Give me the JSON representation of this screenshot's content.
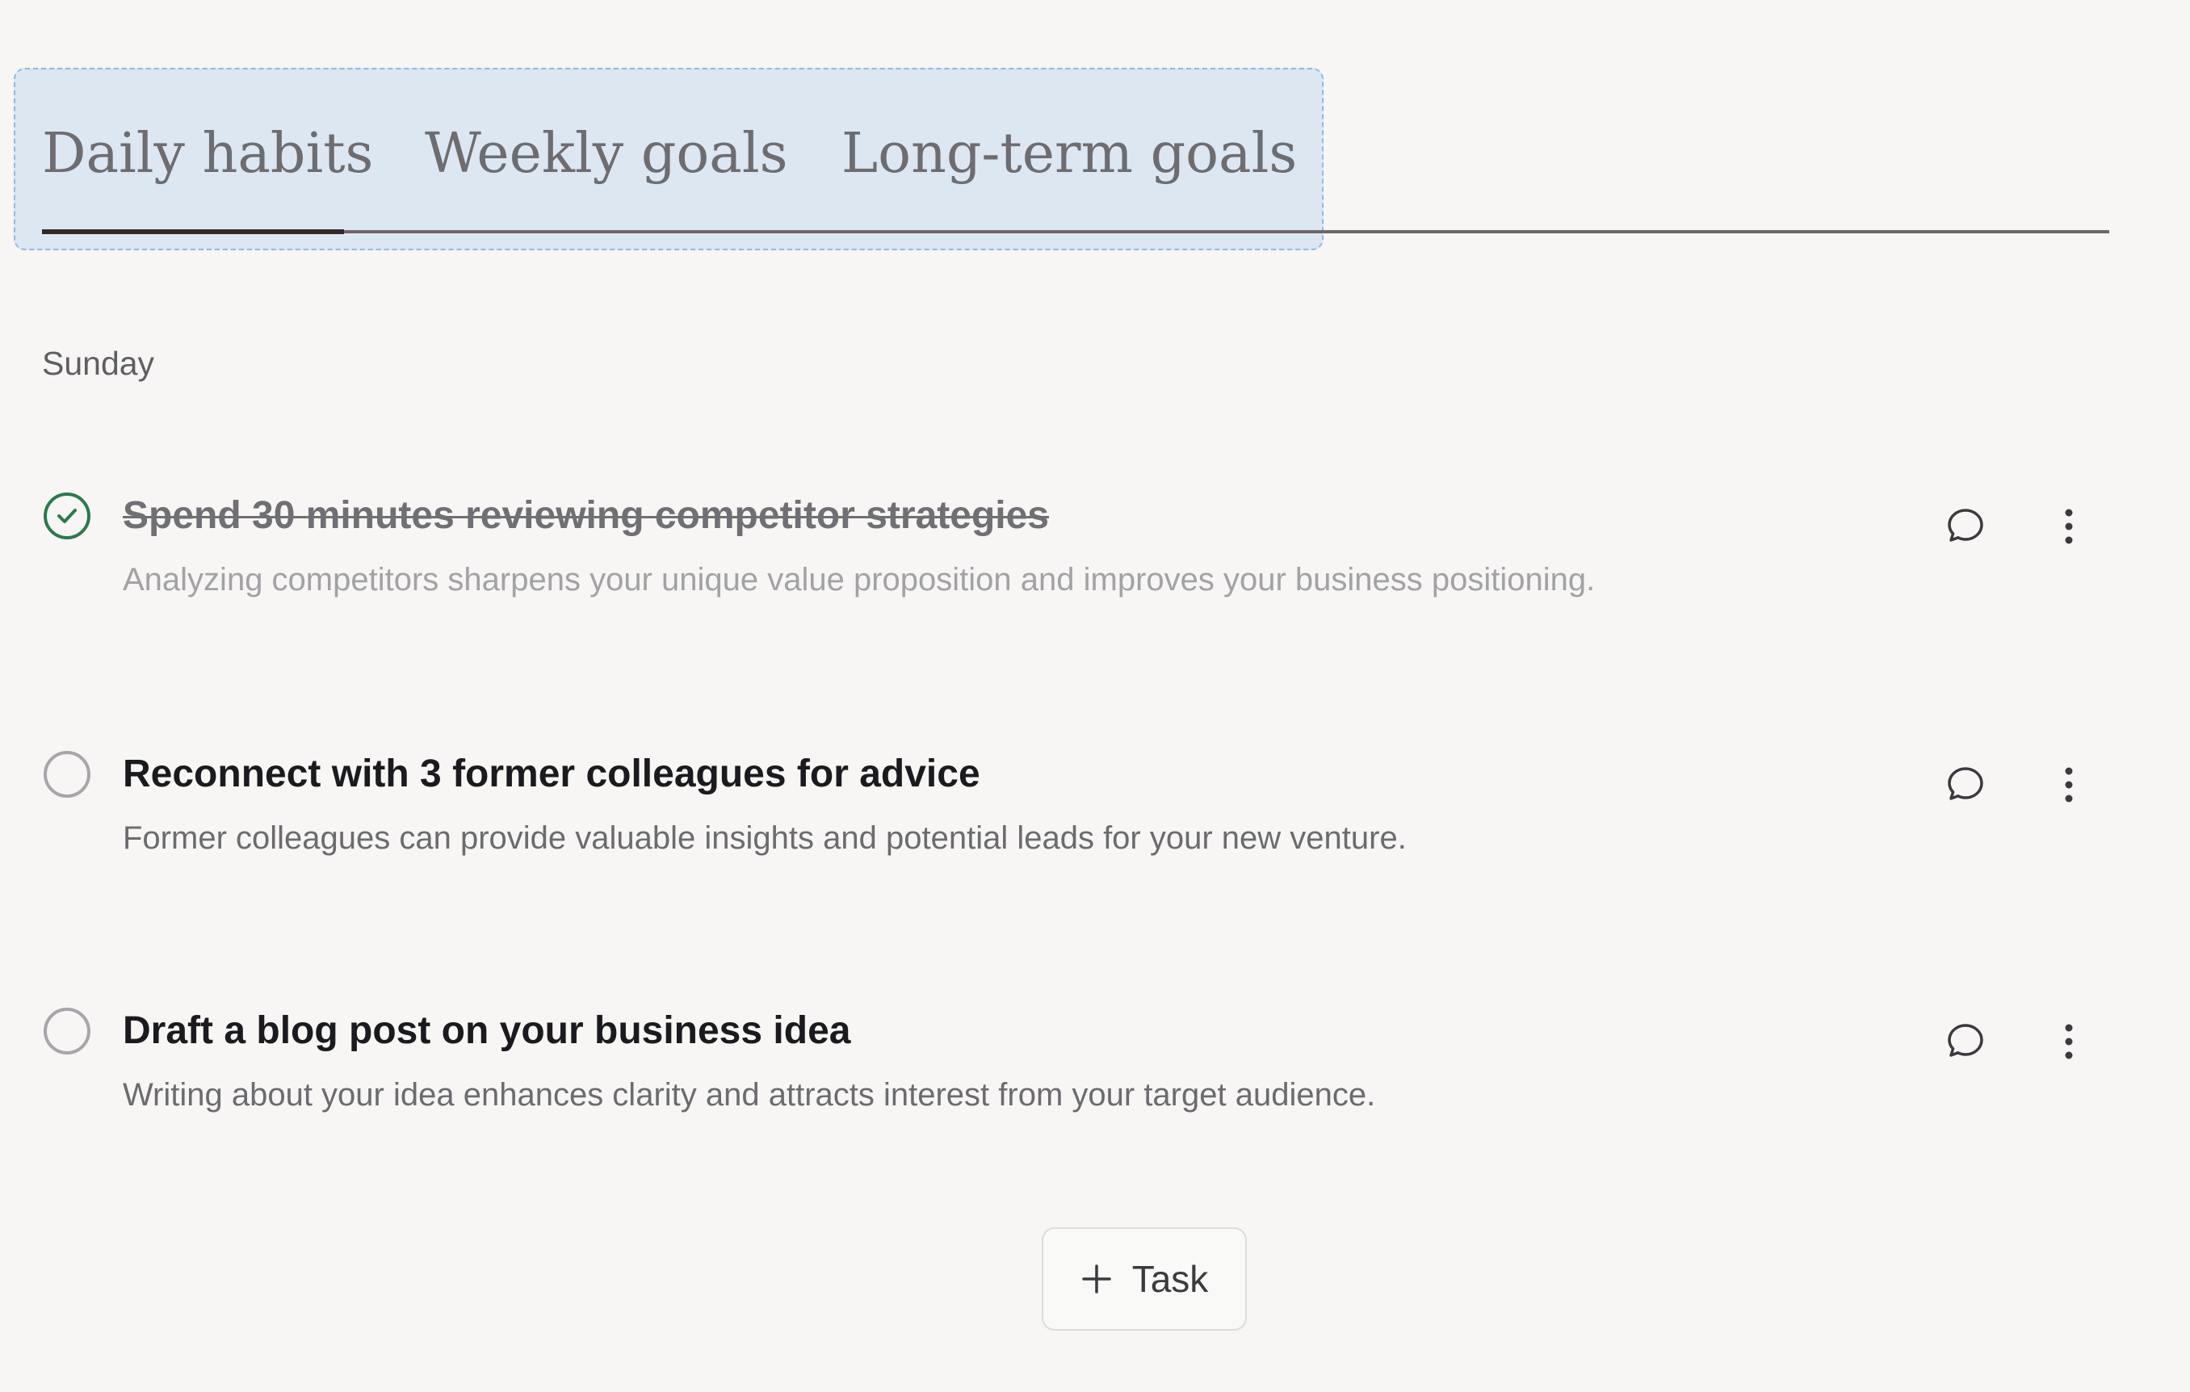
{
  "tabs": [
    {
      "label": "Daily habits",
      "active": true
    },
    {
      "label": "Weekly goals",
      "active": false
    },
    {
      "label": "Long-term goals",
      "active": false
    }
  ],
  "day": "Sunday",
  "tasks": [
    {
      "title": "Spend 30 minutes reviewing competitor strategies",
      "description": "Analyzing competitors sharpens your unique value proposition and improves your business positioning.",
      "completed": true
    },
    {
      "title": "Reconnect with 3 former colleagues for advice",
      "description": "Former colleagues can provide valuable insights and potential leads for your new venture.",
      "completed": false
    },
    {
      "title": "Draft a blog post on your business idea",
      "description": "Writing about your idea enhances clarity and attracts interest from your target audience.",
      "completed": false
    }
  ],
  "add_task": {
    "label": "Task",
    "icon": "plus-icon"
  },
  "icons": {
    "check": "check-circle-icon",
    "comment": "comment-icon",
    "more": "more-vertical-icon"
  },
  "colors": {
    "accent_check": "#2a7a4e",
    "tab_selection_bg": "#dde7f2",
    "tab_selection_border": "#8fb8e6",
    "background": "#f7f6f4"
  }
}
